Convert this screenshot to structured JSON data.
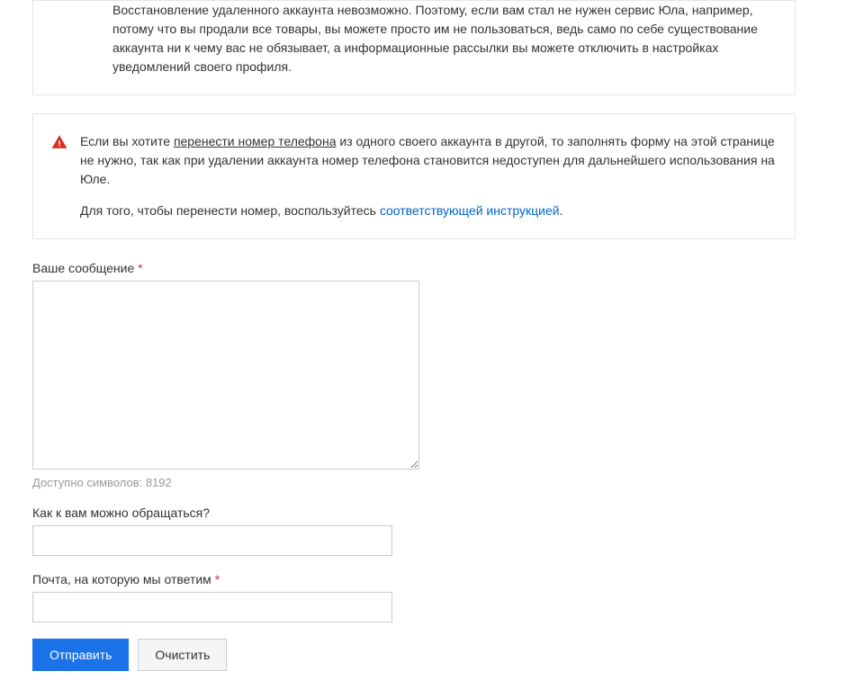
{
  "info_box": {
    "text": "Восстановление удаленного аккаунта невозможно. Поэтому, если вам стал не нужен сервис Юла, например, потому что вы продали все товары, вы можете просто им не пользоваться, ведь само по себе существование аккаунта ни к чему вас не обязывает, а информационные рассылки вы можете отключить в настройках уведомлений своего профиля."
  },
  "warning_box": {
    "p1_before": "Если вы хотите ",
    "p1_underline": "перенести номер телефона",
    "p1_after": " из одного своего аккаунта в другой, то заполнять форму на этой странице не нужно, так как при удалении аккаунта номер телефона становится недоступен для дальнейшего использования на Юле.",
    "p2_before": "Для того, чтобы перенести номер, воспользуйтесь ",
    "p2_link": "соответствующей инструкцией",
    "p2_after": "."
  },
  "form": {
    "message_label": "Ваше сообщение",
    "message_value": "",
    "char_counter": "Доступно символов: 8192",
    "name_label": "Как к вам можно обращаться?",
    "name_value": "",
    "email_label": "Почта, на которую мы ответим",
    "email_value": "",
    "submit_label": "Отправить",
    "clear_label": "Очистить",
    "required_marker": "*"
  }
}
